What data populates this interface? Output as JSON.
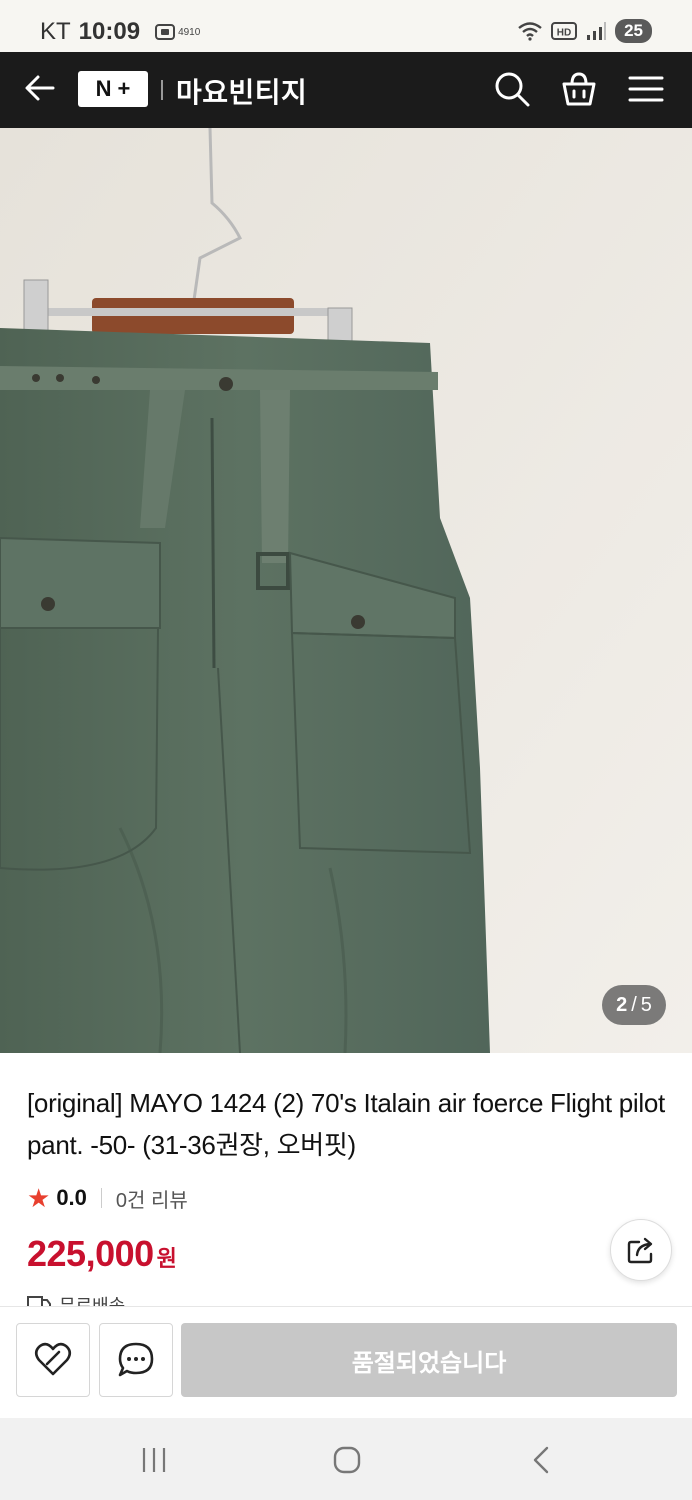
{
  "status_bar": {
    "carrier": "KT",
    "time": "10:09",
    "notification_number": "4910",
    "network_label": "HD",
    "battery": "25"
  },
  "header": {
    "logo_left": "N",
    "logo_right": "+",
    "store_name": "마요빈티지",
    "icons": [
      "back-arrow-icon",
      "search-icon",
      "shopping-bag-icon",
      "menu-icon"
    ]
  },
  "gallery": {
    "current": "2",
    "separator": "/",
    "total": "5"
  },
  "product": {
    "title": "[original] MAYO 1424 (2) 70's Italain air foerce Flight pilot pant. -50- (31-36권장, 오버핏)",
    "rating": "0.0",
    "review_count": "0건 리뷰",
    "price": "225,000",
    "price_unit": "원",
    "shipping_label": "무료배송"
  },
  "bottom_bar": {
    "soldout_label": "품절되었습니다"
  },
  "colors": {
    "header_bg": "#1b1b1b",
    "price_red": "#c8102e",
    "star_red": "#e8402f",
    "soldout_gray": "#c7c7c7"
  }
}
